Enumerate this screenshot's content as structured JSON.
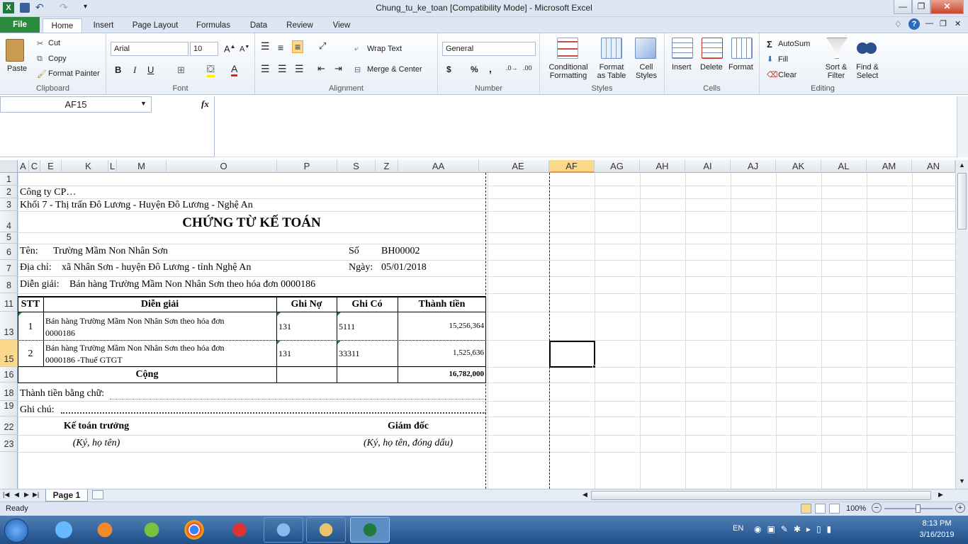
{
  "window": {
    "title": "Chung_tu_ke_toan  [Compatibility Mode]  -  Microsoft Excel"
  },
  "tabs": [
    {
      "label": "File"
    },
    {
      "label": "Home"
    },
    {
      "label": "Insert"
    },
    {
      "label": "Page Layout"
    },
    {
      "label": "Formulas"
    },
    {
      "label": "Data"
    },
    {
      "label": "Review"
    },
    {
      "label": "View"
    }
  ],
  "ribbon": {
    "clipboard": {
      "label": "Clipboard",
      "paste": "Paste",
      "cut": "Cut",
      "copy": "Copy",
      "format_painter": "Format Painter"
    },
    "font": {
      "label": "Font",
      "name": "Arial",
      "size": "10",
      "bold": "B",
      "italic": "I",
      "underline": "U"
    },
    "alignment": {
      "label": "Alignment",
      "wrap_text": "Wrap Text",
      "merge_center": "Merge & Center"
    },
    "number": {
      "label": "Number",
      "format": "General",
      "currency": "$",
      "percent": "%",
      "comma": ","
    },
    "styles": {
      "label": "Styles",
      "conditional_1": "Conditional",
      "conditional_2": "Formatting",
      "format_table_1": "Format",
      "format_table_2": "as Table",
      "cell_styles_1": "Cell",
      "cell_styles_2": "Styles"
    },
    "cells": {
      "label": "Cells",
      "insert": "Insert",
      "delete": "Delete",
      "format": "Format"
    },
    "editing": {
      "label": "Editing",
      "autosum": "AutoSum",
      "fill": "Fill",
      "clear": "Clear",
      "sort_1": "Sort &",
      "sort_2": "Filter",
      "find_1": "Find &",
      "find_2": "Select"
    }
  },
  "formula_bar": {
    "name_box": "AF15",
    "fx": "fx",
    "formula": ""
  },
  "columns": [
    {
      "label": "A"
    },
    {
      "label": "C"
    },
    {
      "label": "E"
    },
    {
      "label": "K"
    },
    {
      "label": "L"
    },
    {
      "label": "M"
    },
    {
      "label": "O"
    },
    {
      "label": "P"
    },
    {
      "label": "S"
    },
    {
      "label": "Z"
    },
    {
      "label": "AA"
    },
    {
      "label": "AE"
    },
    {
      "label": "AF"
    },
    {
      "label": "AG"
    },
    {
      "label": "AH"
    },
    {
      "label": "AI"
    },
    {
      "label": "AJ"
    },
    {
      "label": "AK"
    },
    {
      "label": "AL"
    },
    {
      "label": "AM"
    },
    {
      "label": "AN"
    }
  ],
  "rows": [
    "1",
    "2",
    "3",
    "4",
    "5",
    "6",
    "7",
    "8",
    "11",
    "13",
    "15",
    "16",
    "18",
    "19",
    "22",
    "23"
  ],
  "sheet": {
    "company": "Công ty CP…",
    "address": "Khối 7 - Thị trấn Đô Lương - Huyện Đô Lương - Nghệ An",
    "doc_title": "CHỨNG TỪ KẾ TOÁN",
    "name_label": "Tên:",
    "name_value": "Trường Mầm Non Nhân Sơn",
    "so_label": "Số",
    "so_value": "BH00002",
    "addr_label": "Địa chỉ:",
    "addr_value": "xã Nhân Sơn - huyện Đô Lương - tỉnh Nghệ An",
    "date_label": "Ngày:",
    "date_value": "05/01/2018",
    "desc_label": "Diễn giải:",
    "desc_value": "Bán hàng Trường Mầm Non Nhân Sơn theo hóa đơn 0000186",
    "table_headers": {
      "stt": "STT",
      "desc": "Diễn giải",
      "debit": "Ghi Nợ",
      "credit": "Ghi Có",
      "amount": "Thành tiền"
    },
    "items": [
      {
        "stt": "1",
        "desc_1": "Bán hàng Trường Mầm Non Nhân Sơn theo hóa đơn",
        "desc_2": "0000186",
        "debit": "131",
        "credit": "5111",
        "amount": "15,256,364"
      },
      {
        "stt": "2",
        "desc_1": "Bán hàng Trường Mầm Non Nhân Sơn theo hóa đơn",
        "desc_2": "0000186 -Thuế GTGT",
        "debit": "131",
        "credit": "33311",
        "amount": "1,525,636"
      }
    ],
    "total_label": "Cộng",
    "total_value": "16,782,000",
    "words_label": "Thành tiền bằng chữ:",
    "note_label": "Ghi chú:",
    "sign_left": "Kế toán trưởng",
    "sign_left_sub": "(Ký, họ tên)",
    "sign_right": "Giám đốc",
    "sign_right_sub": "(Ký, họ tên, đóng dấu)"
  },
  "sheet_tab": "Page 1",
  "status": {
    "ready": "Ready",
    "zoom": "100%"
  },
  "taskbar": {
    "lang": "EN",
    "time": "8:13 PM",
    "date": "3/16/2019"
  },
  "colors": {
    "file_tab": "#2a8a3e",
    "selected_header": "#fbd98c",
    "taskbar": "#2a5b94"
  }
}
